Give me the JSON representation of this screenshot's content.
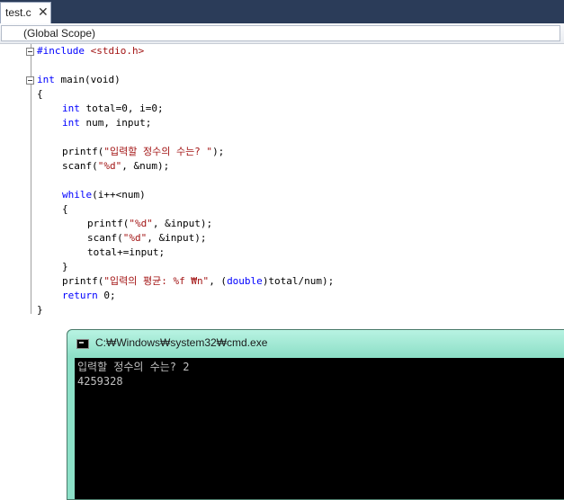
{
  "tab": {
    "label": "test.c",
    "close_glyph": "✕"
  },
  "scope": {
    "label": "(Global Scope)"
  },
  "code": {
    "l1": {
      "directive": "#include",
      "header": "<stdio.h>"
    },
    "l3": {
      "type": "int",
      "sig": " main(void)"
    },
    "l4": "{",
    "l5": {
      "type": "int",
      "rest": " total=0, i=0;"
    },
    "l6": {
      "type": "int",
      "rest": " num, input;"
    },
    "l8": {
      "fn": "printf(",
      "str": "\"입력할 정수의 수는? \"",
      "end": ");"
    },
    "l9": {
      "fn": "scanf(",
      "str": "\"%d\"",
      "end": ", &num);"
    },
    "l11": {
      "kw": "while",
      "rest": "(i++<num)"
    },
    "l12": "{",
    "l13": {
      "fn": "printf(",
      "str": "\"%d\"",
      "end": ", &input);"
    },
    "l14": {
      "fn": "scanf(",
      "str": "\"%d\"",
      "end": ", &input);"
    },
    "l15": "total+=input;",
    "l16": "}",
    "l17": {
      "fn": "printf(",
      "str": "\"입력의 평균: %f ₩n\"",
      "mid": ", (",
      "kw": "double",
      "end": ")total/num);"
    },
    "l18": {
      "kw": "return",
      "end": " 0;"
    },
    "l19": "}"
  },
  "console": {
    "title": "C:₩Windows₩system32₩cmd.exe",
    "lines": [
      "입력할 정수의 수는? 2",
      "4259328"
    ]
  }
}
